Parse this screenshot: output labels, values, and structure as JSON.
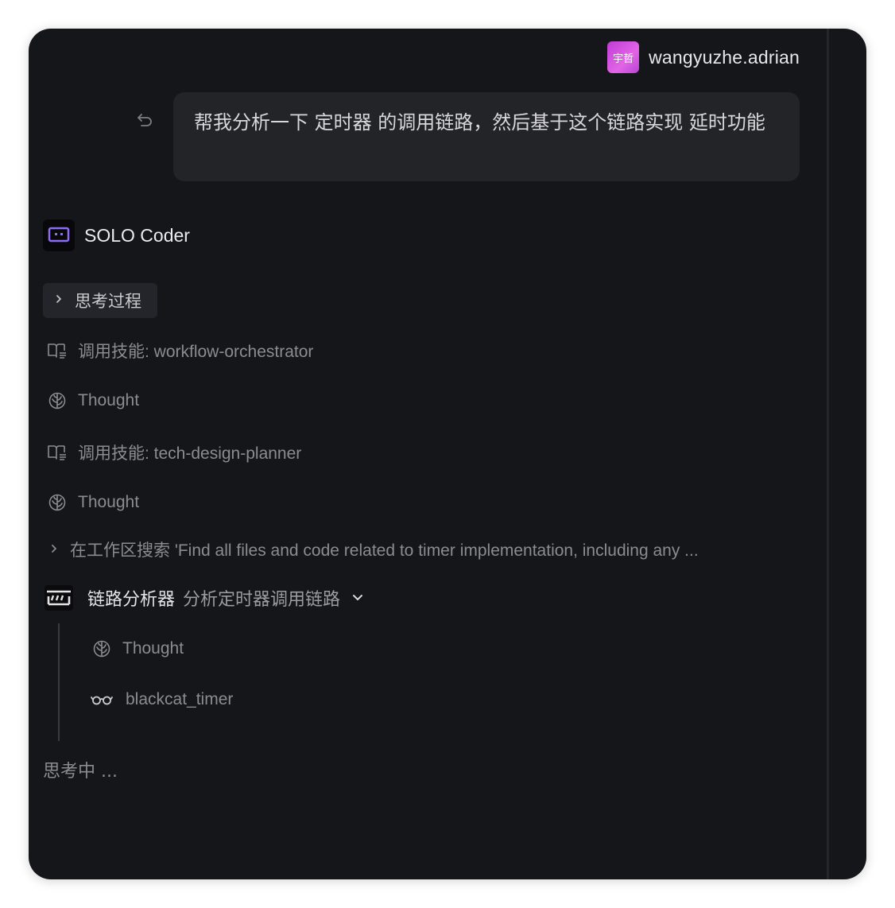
{
  "user": {
    "avatar_text": "宇哲",
    "name": "wangyuzhe.adrian",
    "avatar_color": "#d04fdf"
  },
  "message": {
    "text": "帮我分析一下 定时器 的调用链路，然后基于这个链路实现 延时功能"
  },
  "agent": {
    "name": "SOLO Coder",
    "accent_color": "#8b6cf6"
  },
  "thinking_toggle": {
    "label": "思考过程"
  },
  "steps": [
    {
      "icon": "book-icon",
      "label": "调用技能: workflow-orchestrator"
    },
    {
      "icon": "brain-icon",
      "label": "Thought"
    },
    {
      "icon": "book-icon",
      "label": "调用技能: tech-design-planner"
    },
    {
      "icon": "brain-icon",
      "label": "Thought"
    }
  ],
  "search": {
    "label": "在工作区搜索 'Find all files and code related to timer implementation, including any ..."
  },
  "subagent": {
    "name": "链路分析器",
    "description": "分析定时器调用链路",
    "children": [
      {
        "icon": "brain-icon",
        "label": "Thought"
      },
      {
        "icon": "glasses-icon",
        "label": "blackcat_timer"
      }
    ]
  },
  "status": {
    "text": "思考中 ..."
  }
}
